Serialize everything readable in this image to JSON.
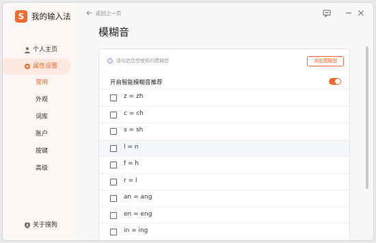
{
  "app": {
    "name": "我的输入法",
    "logo_letter": "S"
  },
  "colors": {
    "accent": "#f26a2e",
    "active_bg": "#fde9e1"
  },
  "sidebar": {
    "items": [
      {
        "label": "个人主页",
        "icon": "person-icon"
      },
      {
        "label": "属性设置",
        "icon": "gear-icon"
      }
    ],
    "subitems": [
      "常用",
      "外观",
      "词库",
      "账户",
      "按键",
      "高级"
    ],
    "about": "关于搜狗"
  },
  "topbar": {
    "back_label": "返回上一页"
  },
  "page": {
    "title": "模糊音"
  },
  "panel": {
    "hint": "请勾选您想使用的模糊音",
    "add_button": "添加模糊音",
    "toggle_label": "开启智能模糊音推荐",
    "toggle_on": true,
    "rows": [
      "z = zh",
      "c = ch",
      "s = sh",
      "l = n",
      "f = h",
      "r = l",
      "an = ang",
      "en = eng",
      "in = ing"
    ]
  }
}
